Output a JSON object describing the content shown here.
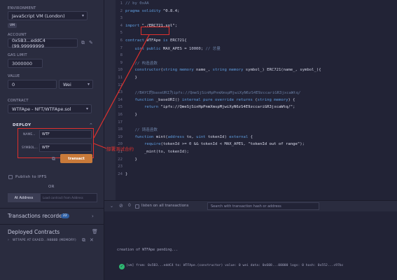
{
  "left_panel": {
    "environment_label": "ENVIRONMENT",
    "environment_value": "JavaScript VM (London)",
    "vm_badge": "VM",
    "account_label": "ACCOUNT",
    "account_value": "0x5B3...eddC4 (99.99999999",
    "gas_label": "GAS LIMIT",
    "gas_value": "3000000",
    "value_label": "VALUE",
    "value_amount": "0",
    "value_unit": "Wei",
    "contract_label": "CONTRACT",
    "contract_value": "WTFApe - NFT/WTFApe.sol",
    "deploy_label": "DEPLOY",
    "param_name_label": "NAME...",
    "param_name_value": "WTF",
    "param_symbol_label": "SYMBOL...",
    "param_symbol_value": "WTF",
    "transact_label": "transact",
    "publish_label": "Publish to IPFS",
    "or_label": "OR",
    "at_address_label": "At Address",
    "load_placeholder": "Load contract from Address",
    "transactions_recorded": "Transactions recorded",
    "transactions_count": "22",
    "deployed_contracts": "Deployed Contracts",
    "deployed_item": "WTFAPE AT 0XAED...9888B (MEMORY)"
  },
  "annotation": {
    "red_note": "部署测试合约"
  },
  "editor": {
    "lines": [
      {
        "n": "1",
        "html": "<span class='cm'>// by 0xAA</span>"
      },
      {
        "n": "2",
        "html": "<span class='kw'>pragma solidity</span> ^0.8.4;"
      },
      {
        "n": "3",
        "html": ""
      },
      {
        "n": "4",
        "html": "<span class='kw'>import</span> <span class='str'>\"./ERC721.sol\"</span>;"
      },
      {
        "n": "5",
        "html": ""
      },
      {
        "n": "6",
        "html": "<span class='kw'>contract</span> WTFApe <span class='kw'>is</span> ERC721{"
      },
      {
        "n": "7",
        "html": "    <span class='kw'>uint public</span> MAX_APES = <span class='num'>10000</span>; <span class='cm'>// 总量</span>"
      },
      {
        "n": "8",
        "html": ""
      },
      {
        "n": "9",
        "html": "    <span class='cm'>// 构造函数</span>"
      },
      {
        "n": "10",
        "html": "    <span class='kw'>constructor</span>(<span class='kw'>string memory</span> name_, <span class='kw'>string memory</span> symbol_) ERC721(name_, symbol_){"
      },
      {
        "n": "11",
        "html": "    }"
      },
      {
        "n": "12",
        "html": ""
      },
      {
        "n": "13",
        "html": "    <span class='cm'>//BAYC的baseURI为ipfs://QmeSjSinHpPnmXmspMjwiXyN6zS4E9zccariGR3jxcaWtq/</span>"
      },
      {
        "n": "14",
        "html": "    <span class='kw'>function</span> _baseURI() <span class='kw'>internal pure override returns</span> (<span class='kw'>string memory</span>) {"
      },
      {
        "n": "15",
        "html": "        <span class='kw'>return</span> <span class='str'>\"ipfs://QmeSjSinHpPnmXmspMjwiXyN6zS4E9zccariGR3jxcaWtq/\"</span>;"
      },
      {
        "n": "16",
        "html": "    }"
      },
      {
        "n": "17",
        "html": ""
      },
      {
        "n": "18",
        "html": "    <span class='cm'>// 铸造函数</span>"
      },
      {
        "n": "19",
        "html": "    <span class='kw'>function</span> mint(<span class='kw'>address</span> to, <span class='kw'>uint</span> tokenId) <span class='kw'>external</span> {"
      },
      {
        "n": "20",
        "html": "        <span class='kw'>require</span>(tokenId >= <span class='num'>0</span> && tokenId < MAX_APES, <span class='str'>\"tokenId out of range\"</span>);"
      },
      {
        "n": "21",
        "html": "        _mint(to, tokenId);"
      },
      {
        "n": "22",
        "html": "    }"
      },
      {
        "n": "23",
        "html": ""
      },
      {
        "n": "24",
        "html": "}"
      }
    ]
  },
  "terminal": {
    "listen_label": "listen on all transactions",
    "search_placeholder": "Search with transaction hash or address",
    "pending": "creation of WTFApe pending...",
    "log": "[vm]  from: 0x5B3...eddC4 to: WTFApe.(constructor) value: 0 wei data: 0x608...00000 logs: 0 hash: 0x552...c97bc"
  },
  "colors": {
    "highlight": "#e0302d",
    "transact": "#c97a3a",
    "success": "#2eb872"
  }
}
